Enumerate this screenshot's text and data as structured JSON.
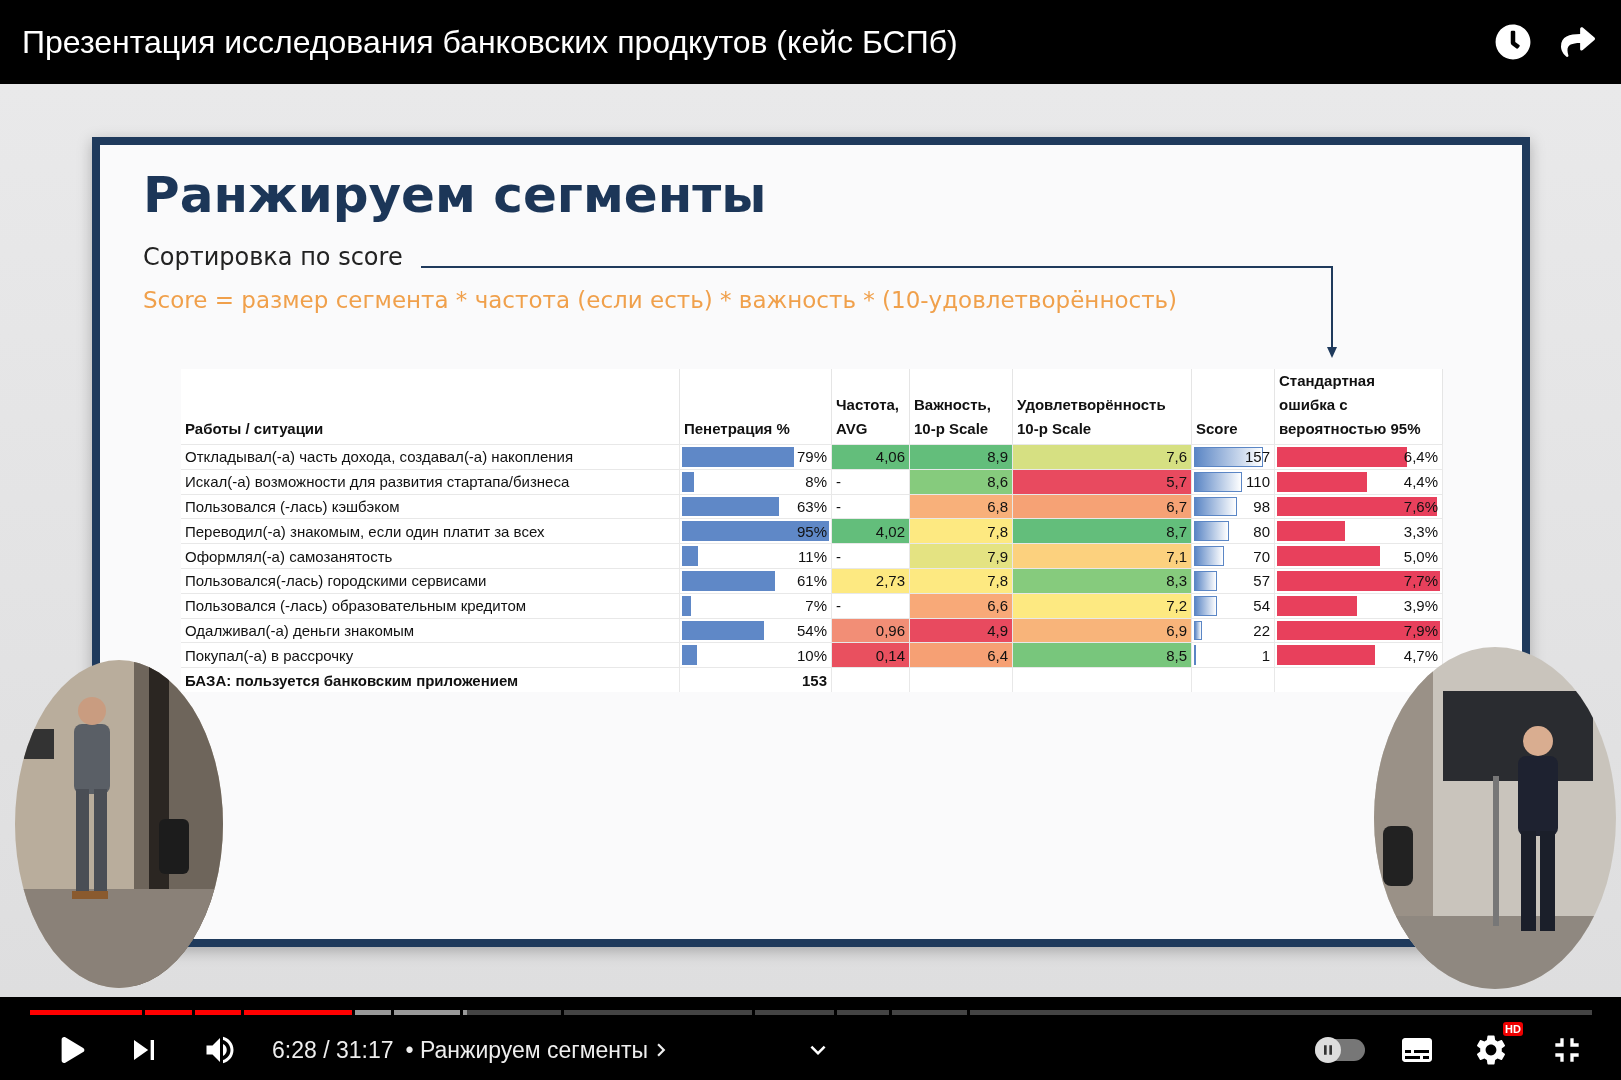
{
  "video_title": "Презентация исследования банковских продкутов (кейс БСПб)",
  "slide": {
    "title": "Ранжируем сегменты",
    "subtitle": "Сортировка по score",
    "formula": "Score = размер сегмента * частота (если есть) * важность * (10-удовлетворённость)"
  },
  "table": {
    "columns": [
      "Работы / ситуации",
      "Пенетрация %",
      "Частота,\nAVG",
      "Важность,\n10-p Scale",
      "Удовлетворённость\n10-p Scale",
      "Score",
      "Стандартная\nошибка с\nвероятностью 95%"
    ],
    "rows": [
      {
        "job": "Откладывал(-а) часть дохода, создавал(-а) накопления",
        "penetration": {
          "text": "79%",
          "level": 0.76
        },
        "frequency": {
          "text": "4,06",
          "color": "#63be7b"
        },
        "importance": {
          "text": "8,9",
          "color": "#63be7b"
        },
        "satisfaction": {
          "text": "7,6",
          "color": "#d6e082"
        },
        "score": {
          "text": "157",
          "level": 0.88
        },
        "error": {
          "text": "6,4%",
          "level": 0.8
        }
      },
      {
        "job": "Искал(-а) возможности для развития стартапа/бизнеса",
        "penetration": {
          "text": "8%",
          "level": 0.08
        },
        "frequency": {
          "text": "-"
        },
        "importance": {
          "text": "8,6",
          "color": "#86cb7d"
        },
        "satisfaction": {
          "text": "5,7",
          "color": "#e84a5f"
        },
        "score": {
          "text": "110",
          "level": 0.62
        },
        "error": {
          "text": "4,4%",
          "level": 0.55
        }
      },
      {
        "job": "Пользовался (-лась) кэшбэком",
        "penetration": {
          "text": "63%",
          "level": 0.66
        },
        "frequency": {
          "text": "-"
        },
        "importance": {
          "text": "6,8",
          "color": "#f8b07a"
        },
        "satisfaction": {
          "text": "6,7",
          "color": "#f6a275"
        },
        "score": {
          "text": "98",
          "level": 0.55
        },
        "error": {
          "text": "7,6%",
          "level": 0.98
        }
      },
      {
        "job": "Переводил(-а) знакомым, если один платит за всех",
        "penetration": {
          "text": "95%",
          "level": 1.0
        },
        "frequency": {
          "text": "4,02",
          "color": "#63be7b"
        },
        "importance": {
          "text": "7,8",
          "color": "#fde981"
        },
        "satisfaction": {
          "text": "8,7",
          "color": "#63be7b"
        },
        "score": {
          "text": "80",
          "level": 0.45
        },
        "error": {
          "text": "3,3%",
          "level": 0.42
        }
      },
      {
        "job": "Оформлял(-а) самозанятость",
        "penetration": {
          "text": "11%",
          "level": 0.11
        },
        "frequency": {
          "text": "-"
        },
        "importance": {
          "text": "7,9",
          "color": "#e4e382"
        },
        "satisfaction": {
          "text": "7,1",
          "color": "#fcd17e"
        },
        "score": {
          "text": "70",
          "level": 0.38
        },
        "error": {
          "text": "5,0%",
          "level": 0.63
        }
      },
      {
        "job": "Пользовался(-лась) городскими сервисами",
        "penetration": {
          "text": "61%",
          "level": 0.63
        },
        "frequency": {
          "text": "2,73",
          "color": "#fde981"
        },
        "importance": {
          "text": "7,8",
          "color": "#fde981"
        },
        "satisfaction": {
          "text": "8,3",
          "color": "#86cb7d"
        },
        "score": {
          "text": "57",
          "level": 0.3
        },
        "error": {
          "text": "7,7%",
          "level": 1.0
        }
      },
      {
        "job": "Пользовался (-лась) образовательным кредитом",
        "penetration": {
          "text": "7%",
          "level": 0.06
        },
        "frequency": {
          "text": "-"
        },
        "importance": {
          "text": "6,6",
          "color": "#f8a978"
        },
        "satisfaction": {
          "text": "7,2",
          "color": "#fde981"
        },
        "score": {
          "text": "54",
          "level": 0.29
        },
        "error": {
          "text": "3,9%",
          "level": 0.49
        }
      },
      {
        "job": "Одалживал(-а) деньги знакомым",
        "penetration": {
          "text": "54%",
          "level": 0.56
        },
        "frequency": {
          "text": "0,96",
          "color": "#f28e76"
        },
        "importance": {
          "text": "4,9",
          "color": "#e84a5f"
        },
        "satisfaction": {
          "text": "6,9",
          "color": "#f8b47a"
        },
        "score": {
          "text": "22",
          "level": 0.1
        },
        "error": {
          "text": "7,9%",
          "level": 1.0
        }
      },
      {
        "job": "Покупал(-а) в рассрочку",
        "penetration": {
          "text": "10%",
          "level": 0.1
        },
        "frequency": {
          "text": "0,14",
          "color": "#e9505f"
        },
        "importance": {
          "text": "6,4",
          "color": "#f6a074"
        },
        "satisfaction": {
          "text": "8,5",
          "color": "#78c67c"
        },
        "score": {
          "text": "1",
          "level": 0.01
        },
        "error": {
          "text": "4,7%",
          "level": 0.6
        }
      }
    ],
    "base_row": {
      "label": "БАЗА: пользуется банковским приложением",
      "value": "153"
    }
  },
  "player": {
    "progress": {
      "level": 0.207
    },
    "buffer": {
      "level": 0.28
    },
    "time": "6:28 / 31:17",
    "chapter": "• Ранжируем сегменты",
    "autoplay": {
      "on": false
    },
    "quality_badge": "HD"
  }
}
